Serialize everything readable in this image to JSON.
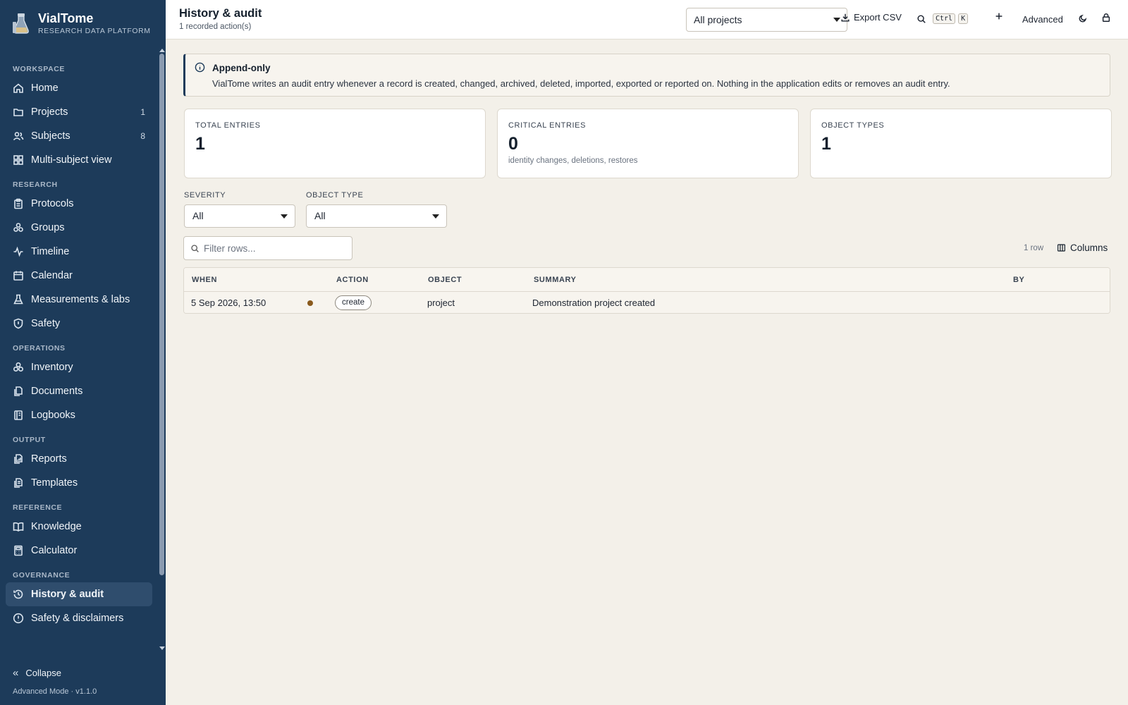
{
  "app": {
    "name": "VialTome",
    "tagline": "RESEARCH DATA PLATFORM",
    "version_text": "Advanced Mode · v1.1.0",
    "collapse_label": "Collapse"
  },
  "sidebar": {
    "sections": [
      {
        "title": "WORKSPACE",
        "items": [
          {
            "label": "Home",
            "icon": "home-icon",
            "badge": ""
          },
          {
            "label": "Projects",
            "icon": "folder-icon",
            "badge": "1"
          },
          {
            "label": "Subjects",
            "icon": "users-icon",
            "badge": "8"
          },
          {
            "label": "Multi-subject view",
            "icon": "grid-icon",
            "badge": ""
          }
        ]
      },
      {
        "title": "RESEARCH",
        "items": [
          {
            "label": "Protocols",
            "icon": "clipboard-icon",
            "badge": ""
          },
          {
            "label": "Groups",
            "icon": "groups-icon",
            "badge": ""
          },
          {
            "label": "Timeline",
            "icon": "activity-icon",
            "badge": ""
          },
          {
            "label": "Calendar",
            "icon": "calendar-icon",
            "badge": ""
          },
          {
            "label": "Measurements & labs",
            "icon": "flask-icon",
            "badge": ""
          },
          {
            "label": "Safety",
            "icon": "shield-icon",
            "badge": ""
          }
        ]
      },
      {
        "title": "OPERATIONS",
        "items": [
          {
            "label": "Inventory",
            "icon": "boxes-icon",
            "badge": ""
          },
          {
            "label": "Documents",
            "icon": "files-icon",
            "badge": ""
          },
          {
            "label": "Logbooks",
            "icon": "notebook-icon",
            "badge": ""
          }
        ]
      },
      {
        "title": "OUTPUT",
        "items": [
          {
            "label": "Reports",
            "icon": "report-icon",
            "badge": ""
          },
          {
            "label": "Templates",
            "icon": "template-icon",
            "badge": ""
          }
        ]
      },
      {
        "title": "REFERENCE",
        "items": [
          {
            "label": "Knowledge",
            "icon": "book-icon",
            "badge": ""
          },
          {
            "label": "Calculator",
            "icon": "calculator-icon",
            "badge": ""
          }
        ]
      },
      {
        "title": "GOVERNANCE",
        "items": [
          {
            "label": "History & audit",
            "icon": "history-icon",
            "badge": "",
            "active": true
          },
          {
            "label": "Safety & disclaimers",
            "icon": "alert-icon",
            "badge": ""
          }
        ]
      }
    ]
  },
  "topbar": {
    "title": "History & audit",
    "subtitle": "1 recorded action(s)",
    "project_select": "All projects",
    "export_label": "Export CSV",
    "search_kbd_1": "Ctrl",
    "search_kbd_2": "K",
    "advanced_label": "Advanced"
  },
  "notice": {
    "title": "Append-only",
    "text": "VialTome writes an audit entry whenever a record is created, changed, archived, deleted, imported, exported or reported on. Nothing in the application edits or removes an audit entry."
  },
  "stats": [
    {
      "label": "TOTAL ENTRIES",
      "value": "1",
      "note": ""
    },
    {
      "label": "CRITICAL ENTRIES",
      "value": "0",
      "note": "identity changes, deletions, restores"
    },
    {
      "label": "OBJECT TYPES",
      "value": "1",
      "note": ""
    }
  ],
  "filters": {
    "severity_label": "SEVERITY",
    "severity_value": "All",
    "object_type_label": "OBJECT TYPE",
    "object_type_value": "All"
  },
  "table": {
    "filter_placeholder": "Filter rows...",
    "row_count": "1 row",
    "columns_label": "Columns",
    "headers": {
      "when": "WHEN",
      "action": "ACTION",
      "object": "OBJECT",
      "summary": "SUMMARY",
      "by": "BY"
    },
    "rows": [
      {
        "when": "5 Sep 2026, 13:50",
        "severity_color": "#8a5a1d",
        "action": "create",
        "object": "project",
        "summary": "Demonstration project created",
        "by": ""
      }
    ]
  }
}
